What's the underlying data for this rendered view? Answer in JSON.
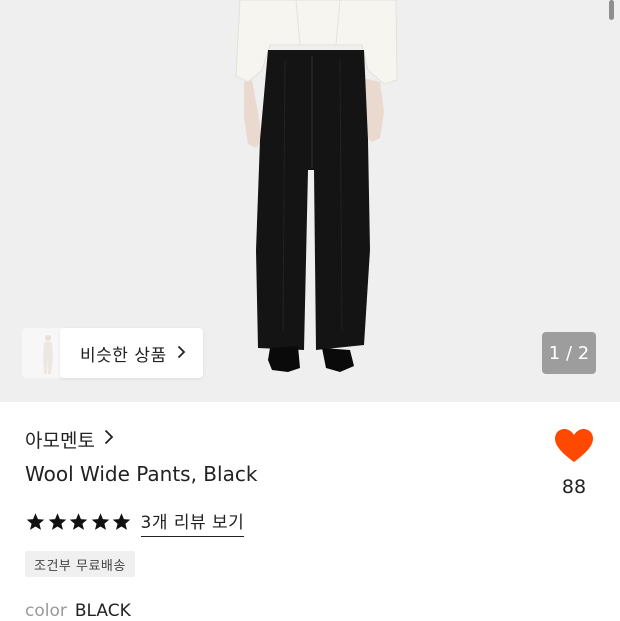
{
  "gallery": {
    "page_indicator": "1 / 2",
    "similar_button_label": "비슷한 상품"
  },
  "product": {
    "brand": "아모멘토",
    "name": "Wool Wide Pants, Black",
    "rating_stars": 5,
    "review_link": "3개 리뷰 보기",
    "shipping_badge": "조건부 무료배송",
    "color_label": "color",
    "color_value": "BLACK"
  },
  "like": {
    "count": "88",
    "color": "#ff4800"
  },
  "icons": {
    "similar_chevron": "chevron-right-icon",
    "brand_chevron": "chevron-right-icon",
    "like": "heart-icon",
    "rating": "star-icon"
  }
}
